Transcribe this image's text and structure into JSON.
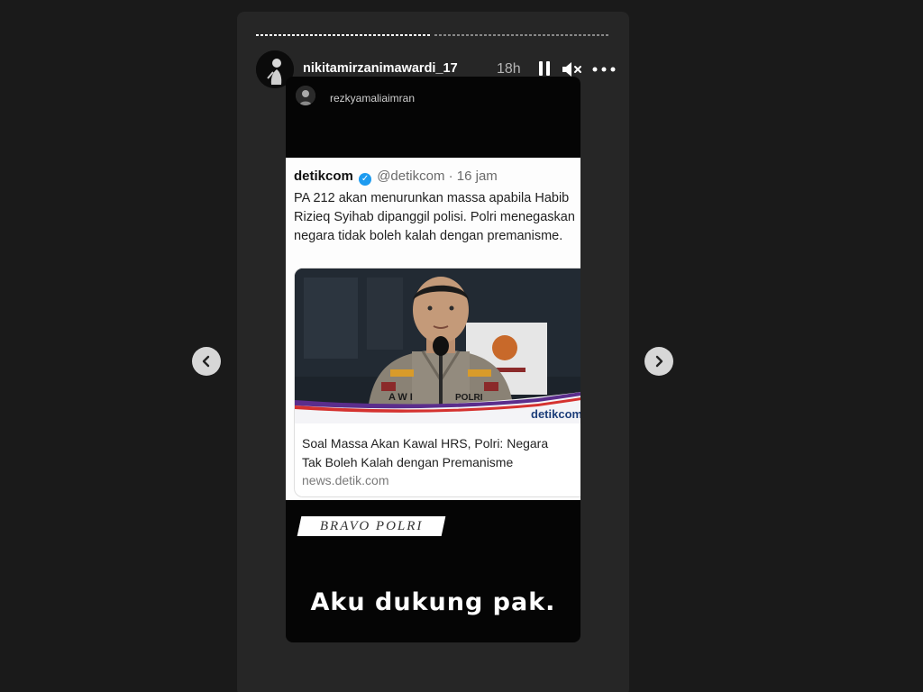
{
  "header": {
    "username": "nikitamirzanimawardi_17",
    "time_ago": "18h",
    "progress_segments": [
      1,
      0
    ],
    "icons": [
      "pause-icon",
      "mute-icon",
      "more-icon"
    ]
  },
  "story": {
    "reposted_from": "rezkyamaliaimran",
    "tweet": {
      "author_name": "detikcom",
      "handle_time": "@detikcom · 16 jam",
      "text": "PA 212 akan menurunkan massa apabila Habib Rizieq Syihab dipanggil polisi. Polri menegaskan negara tidak boleh kalah dengan premanisme.",
      "link_card": {
        "image_caption_badge": "AWI",
        "image_badge_polri": "POLRI",
        "image_brand": "detikcom",
        "title_line1": "Soal Massa Akan Kawal HRS, Polri: Negara",
        "title_line2": "Tak Boleh Kalah dengan Premanisme",
        "domain": "news.detik.com"
      }
    },
    "sticker_text": "BRAVO POLRI",
    "caption_text": "Aku dukung pak."
  },
  "navigation": {
    "prev_icon": "chevron-left-icon",
    "next_icon": "chevron-right-icon"
  },
  "colors": {
    "background": "#1a1a1a",
    "frame": "#262626",
    "verified_blue": "#1d9bf0"
  }
}
